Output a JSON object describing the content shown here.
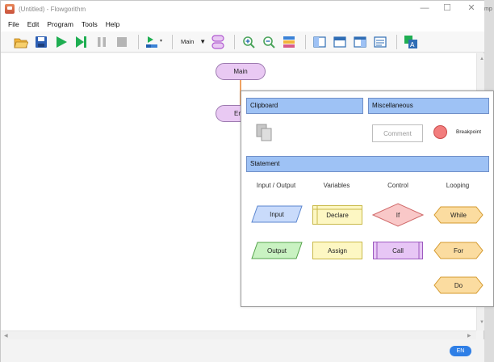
{
  "window": {
    "title": "(Untitled) - Flowgorithm",
    "controls": {
      "minimize": "—",
      "maximize": "☐",
      "close": "✕"
    },
    "peek_text": "mp"
  },
  "menu": [
    "File",
    "Edit",
    "Program",
    "Tools",
    "Help"
  ],
  "toolbar": {
    "function_select": "Main",
    "icons": [
      "open-folder-icon",
      "save-icon",
      "run-icon",
      "step-icon",
      "pause-icon",
      "stop-icon",
      "speed-icon",
      "function-select",
      "variables-icon",
      "zoom-in-icon",
      "zoom-out-icon",
      "layout-icon",
      "layout-1-icon",
      "layout-2-icon",
      "layout-3-icon",
      "layout-4-icon",
      "source-code-icon"
    ]
  },
  "flowchart": {
    "main_label": "Main",
    "end_label": "End",
    "end_visible": "Er"
  },
  "popup": {
    "clipboard": {
      "title": "Clipboard"
    },
    "misc": {
      "title": "Miscellaneous",
      "comment": "Comment",
      "breakpoint": "Breakpoint"
    },
    "statement": {
      "title": "Statement",
      "columns": [
        "Input / Output",
        "Variables",
        "Control",
        "Looping"
      ],
      "input": "Input",
      "output": "Output",
      "declare": "Declare",
      "assign": "Assign",
      "if": "If",
      "call": "Call",
      "while": "While",
      "for": "For",
      "do": "Do"
    }
  },
  "status": {
    "language": "EN"
  },
  "colors": {
    "header_fill": "#9ec2f5",
    "pill_fill": "#e9c9f3",
    "input_fill": "#c9dbfb",
    "output_fill": "#c9f2c2",
    "variable_fill": "#fdf7c3",
    "if_fill": "#f9c8c8",
    "call_fill": "#e7c6f5",
    "loop_fill": "#fbdca0",
    "badge": "#2f7fe6"
  }
}
